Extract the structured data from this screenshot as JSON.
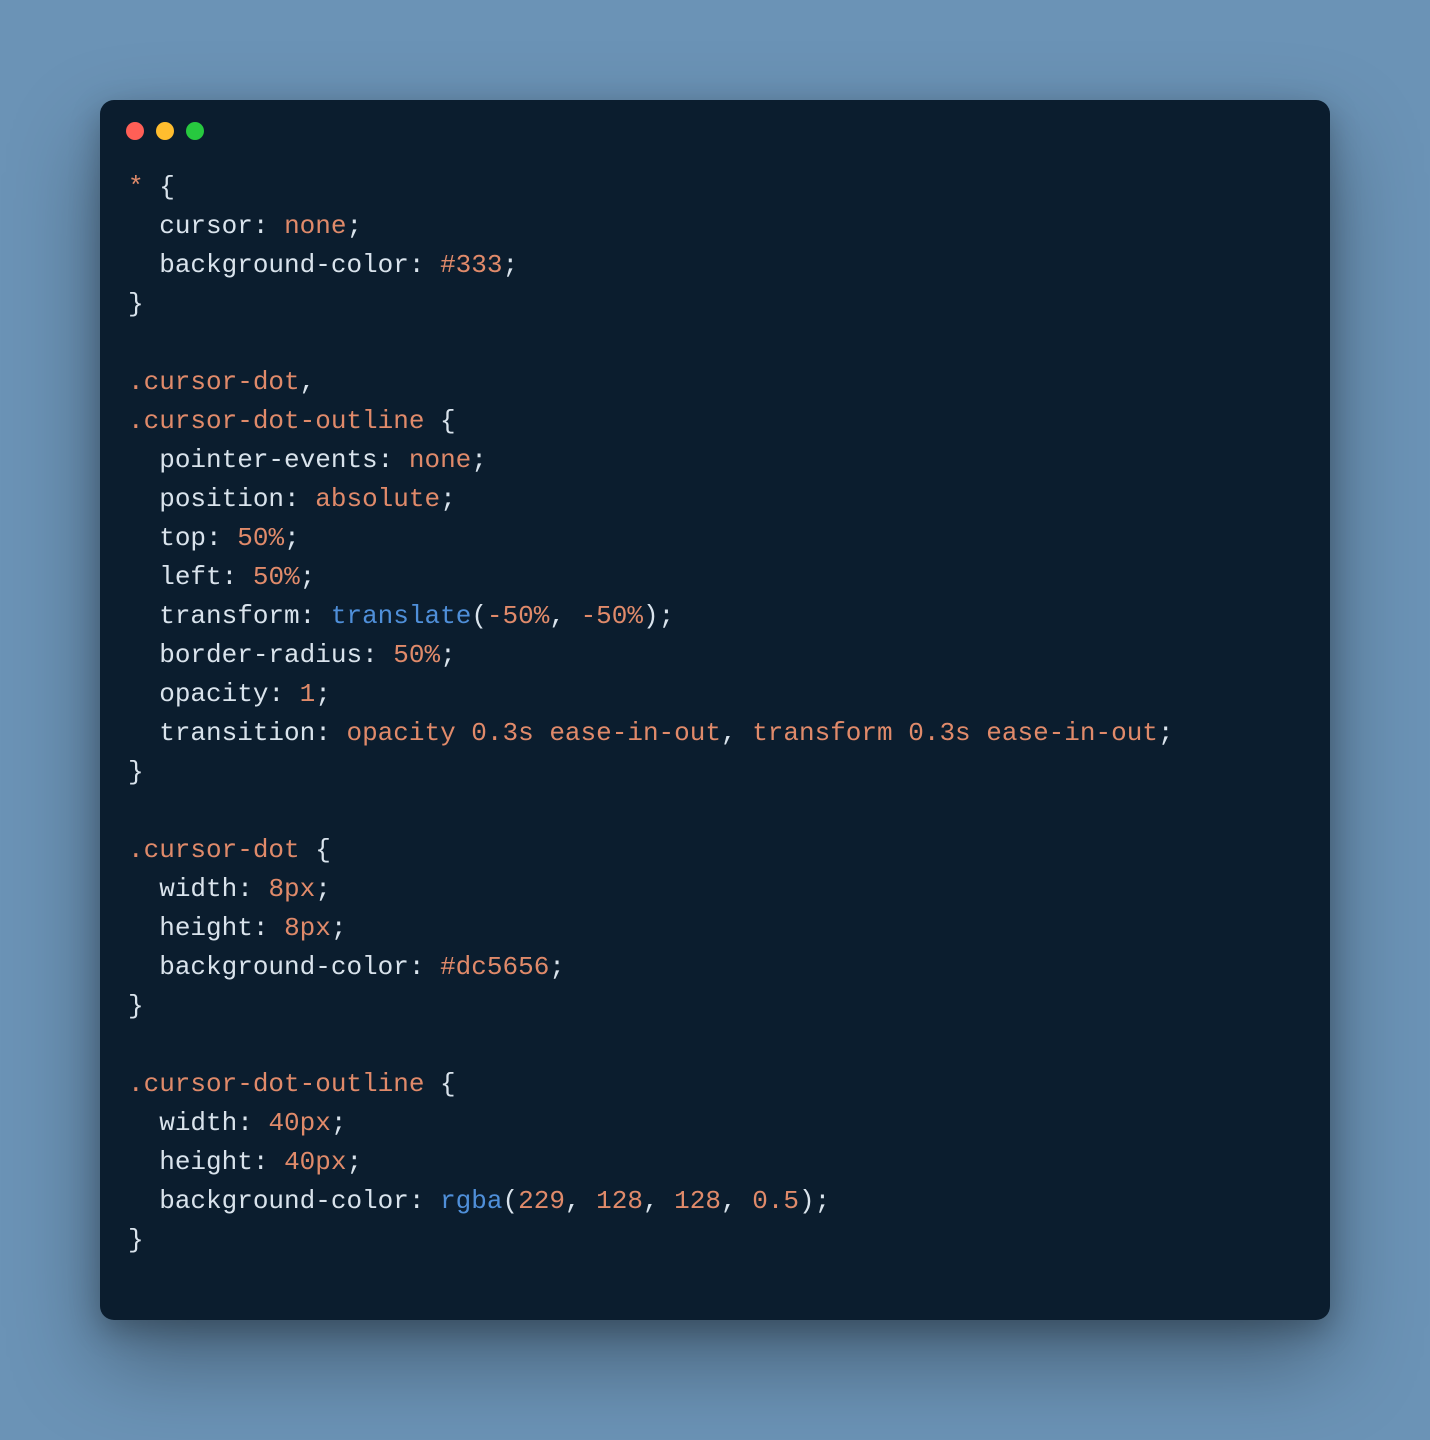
{
  "window": {
    "traffic_lights": {
      "red": "#ff5f56",
      "yellow": "#ffbd2e",
      "green": "#27c93f"
    }
  },
  "code": {
    "r1": {
      "sel": "*",
      "brace": " {"
    },
    "r1a": {
      "prop": "cursor",
      "colon": ": ",
      "val": "none",
      "semi": ";"
    },
    "r1b": {
      "prop": "background-color",
      "colon": ": ",
      "val": "#333",
      "semi": ";"
    },
    "r1c": {
      "brace": "}"
    },
    "r2a": {
      "sel": ".cursor-dot",
      "comma": ","
    },
    "r2b": {
      "sel": ".cursor-dot-outline",
      "brace": " {"
    },
    "r2c": {
      "prop": "pointer-events",
      "colon": ": ",
      "val": "none",
      "semi": ";"
    },
    "r2d": {
      "prop": "position",
      "colon": ": ",
      "val": "absolute",
      "semi": ";"
    },
    "r2e": {
      "prop": "top",
      "colon": ": ",
      "val": "50%",
      "semi": ";"
    },
    "r2f": {
      "prop": "left",
      "colon": ": ",
      "val": "50%",
      "semi": ";"
    },
    "r2g": {
      "prop": "transform",
      "colon": ": ",
      "func": "translate",
      "lp": "(",
      "a1": "-50%",
      "c1": ", ",
      "a2": "-50%",
      "rp": ")",
      "semi": ";"
    },
    "r2h": {
      "prop": "border-radius",
      "colon": ": ",
      "val": "50%",
      "semi": ";"
    },
    "r2i": {
      "prop": "opacity",
      "colon": ": ",
      "val": "1",
      "semi": ";"
    },
    "r2j": {
      "prop": "transition",
      "colon": ": ",
      "p1": "opacity",
      "p2": "0.3s",
      "p3": "ease-in-out",
      "c1": ", ",
      "p4": "transform",
      "p5": "0.3s",
      "p6": "ease-in-out",
      "semi": ";"
    },
    "r2k": {
      "brace": "}"
    },
    "r3a": {
      "sel": ".cursor-dot",
      "brace": " {"
    },
    "r3b": {
      "prop": "width",
      "colon": ": ",
      "val": "8px",
      "semi": ";"
    },
    "r3c": {
      "prop": "height",
      "colon": ": ",
      "val": "8px",
      "semi": ";"
    },
    "r3d": {
      "prop": "background-color",
      "colon": ": ",
      "val": "#dc5656",
      "semi": ";"
    },
    "r3e": {
      "brace": "}"
    },
    "r4a": {
      "sel": ".cursor-dot-outline",
      "brace": " {"
    },
    "r4b": {
      "prop": "width",
      "colon": ": ",
      "val": "40px",
      "semi": ";"
    },
    "r4c": {
      "prop": "height",
      "colon": ": ",
      "val": "40px",
      "semi": ";"
    },
    "r4d": {
      "prop": "background-color",
      "colon": ": ",
      "func": "rgba",
      "lp": "(",
      "a1": "229",
      "c1": ", ",
      "a2": "128",
      "c2": ", ",
      "a3": "128",
      "c3": ", ",
      "a4": "0.5",
      "rp": ")",
      "semi": ";"
    },
    "r4e": {
      "brace": "}"
    }
  }
}
